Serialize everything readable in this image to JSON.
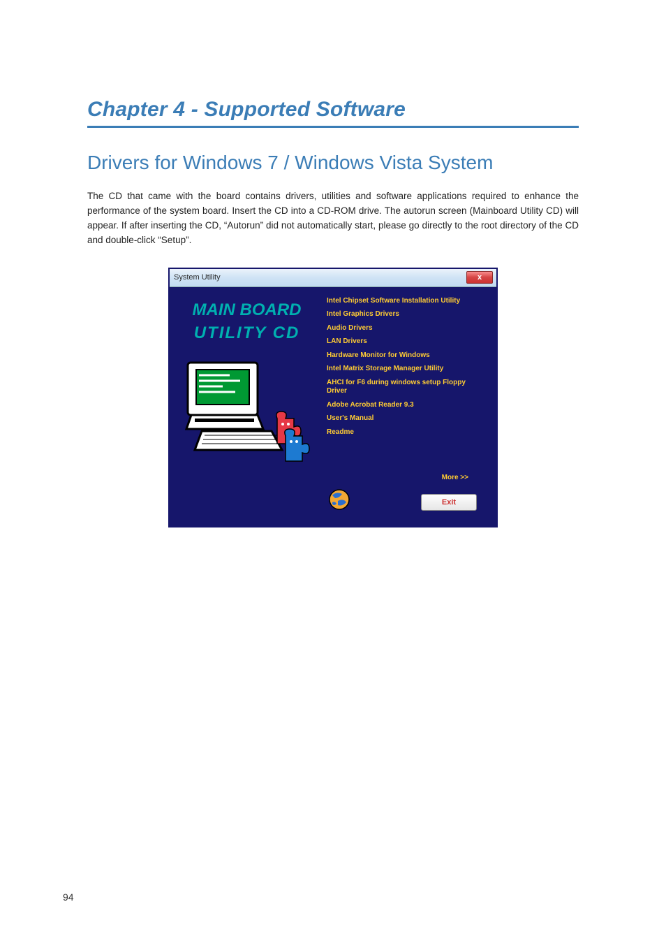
{
  "chapter": {
    "title": "Chapter 4 - Supported Software"
  },
  "section": {
    "title": "Drivers for Windows 7 / Windows Vista System"
  },
  "paragraph": {
    "text": "The CD that came with the board contains drivers, utilities and software applications required to enhance the performance of the system board. Insert the CD into a CD-ROM drive. The autorun screen (Mainboard Utility CD) will appear. If after inserting the CD, “Autorun” did not automatically start, please go directly to the root directory of the CD and double-click “Setup”."
  },
  "window": {
    "title": "System Utility",
    "close_label": "x",
    "brand_line1": "MAIN BOARD",
    "brand_line2": "UTILITY CD",
    "menu": [
      "Intel Chipset Software Installation Utility",
      "Intel Graphics Drivers",
      "Audio Drivers",
      "LAN Drivers",
      "Hardware Monitor for Windows",
      "Intel Matrix Storage Manager Utility",
      "AHCI for F6 during windows setup Floppy Driver",
      "Adobe Acrobat Reader 9.3",
      "User's Manual",
      "Readme"
    ],
    "more_label": "More >>",
    "exit_label": "Exit"
  },
  "footer": {
    "page_number": "94"
  }
}
